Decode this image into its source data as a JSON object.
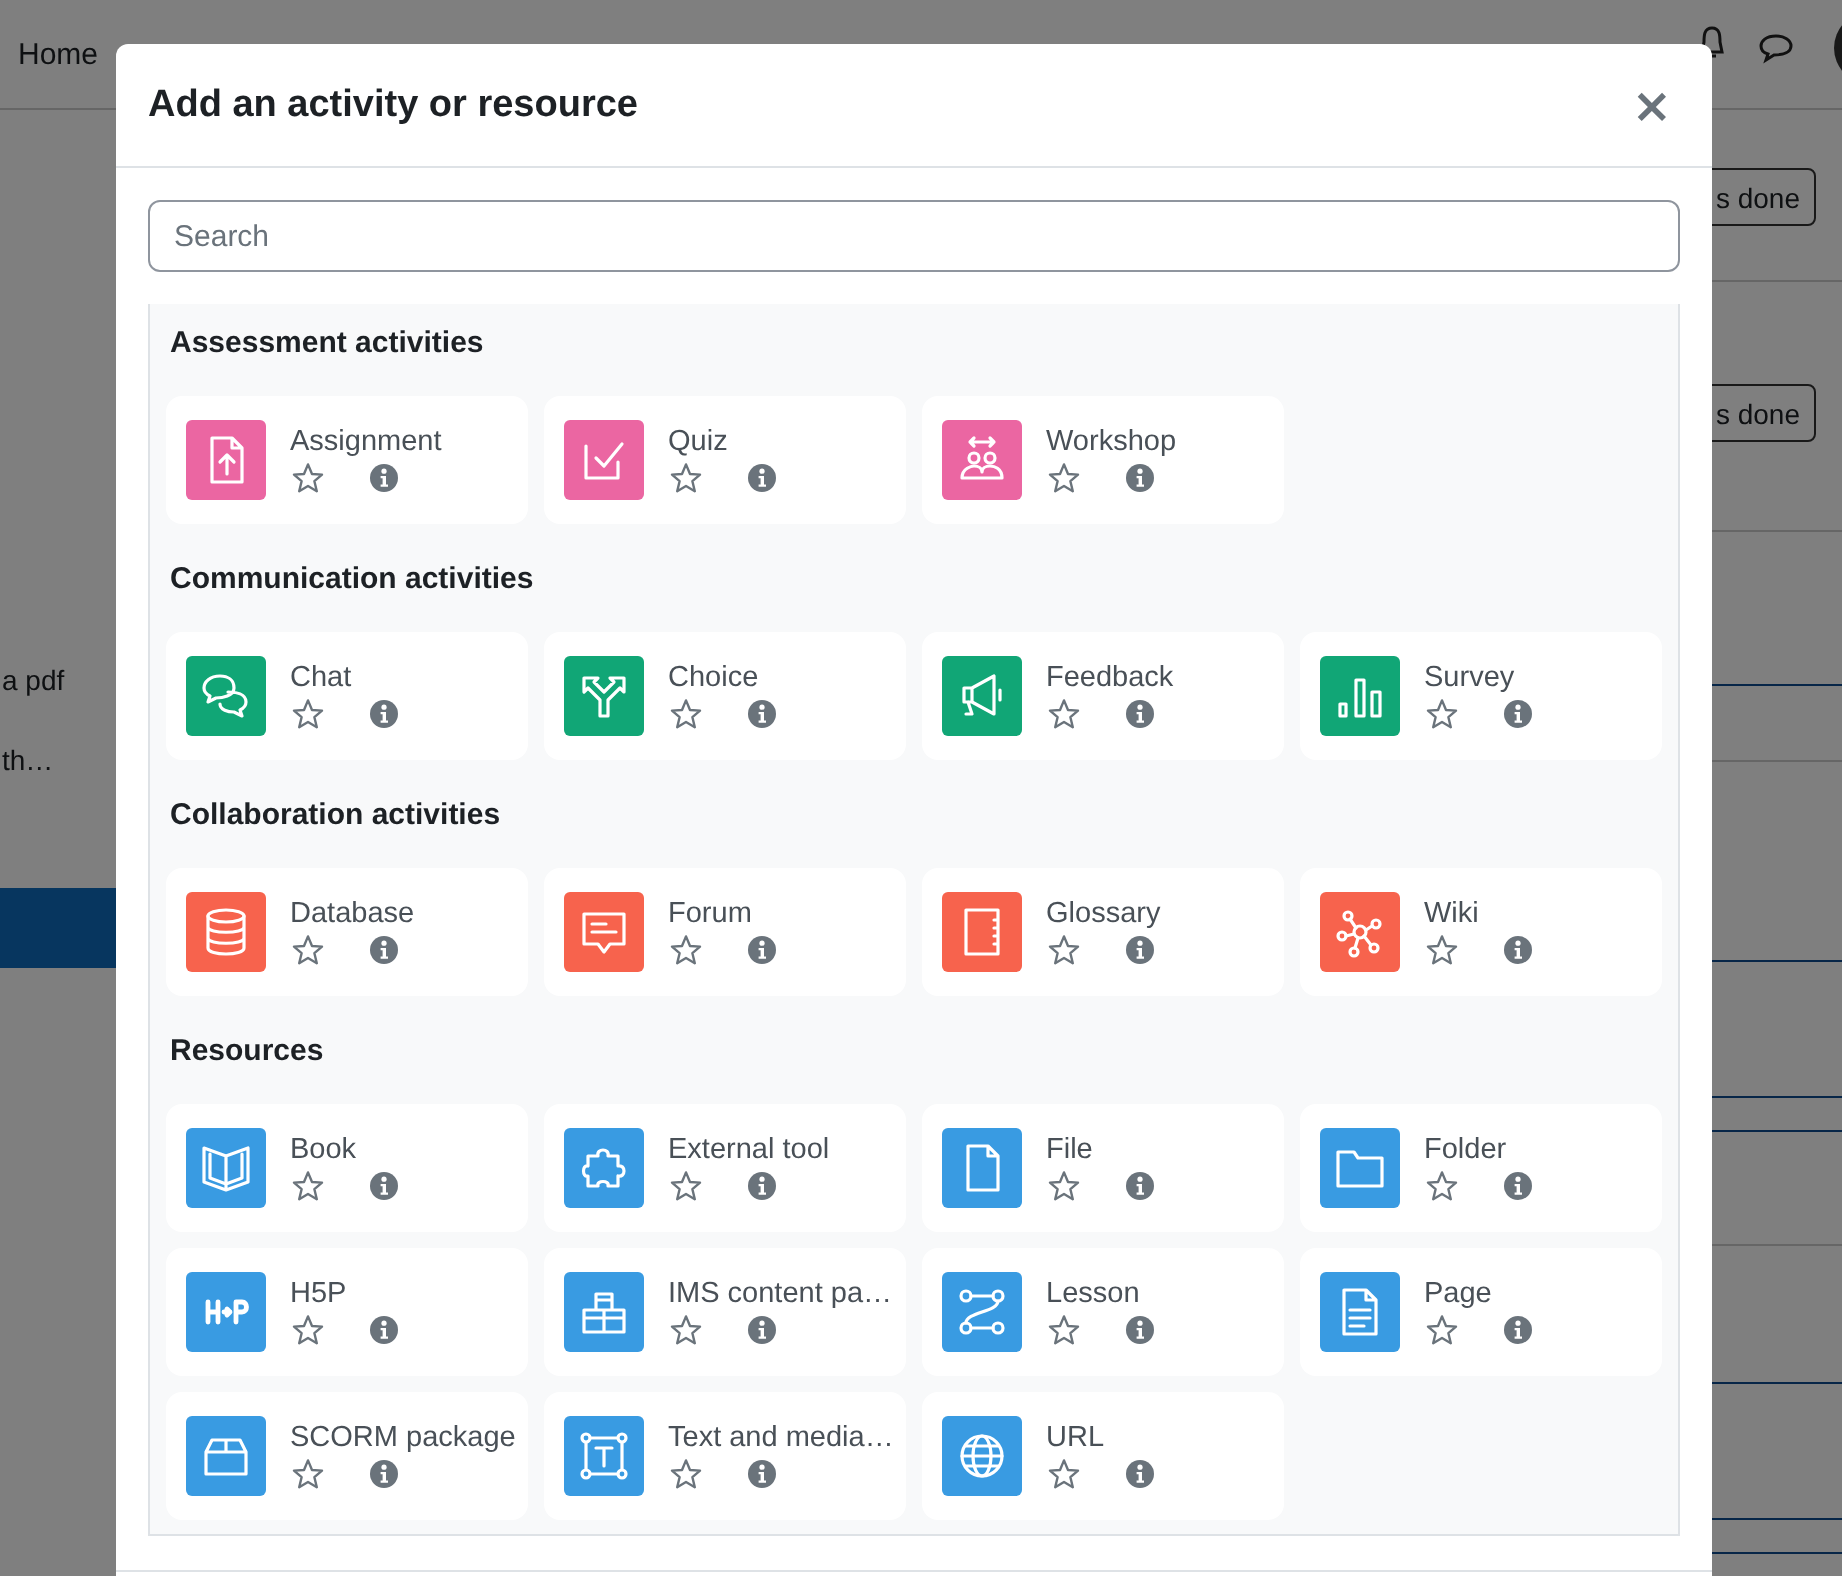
{
  "page": {
    "nav": [
      "Home"
    ],
    "side_texts": [
      "a pdf",
      "th…"
    ],
    "buttons": [
      "s done",
      "s done"
    ]
  },
  "dialog": {
    "title": "Add an activity or resource",
    "close": "×",
    "search": {
      "placeholder": "Search"
    },
    "sections": [
      {
        "title": "Assessment activities",
        "color": "#eb66a2",
        "items": [
          {
            "name": "Assignment",
            "kind": "assignment",
            "starred": false
          },
          {
            "name": "Quiz",
            "kind": "quiz",
            "starred": false
          },
          {
            "name": "Workshop",
            "kind": "workshop",
            "starred": false
          }
        ]
      },
      {
        "title": "Communication activities",
        "color": "#11a676",
        "items": [
          {
            "name": "Chat",
            "kind": "chat",
            "starred": false
          },
          {
            "name": "Choice",
            "kind": "choice",
            "starred": false
          },
          {
            "name": "Feedback",
            "kind": "feedback",
            "starred": false
          },
          {
            "name": "Survey",
            "kind": "survey",
            "starred": false
          }
        ]
      },
      {
        "title": "Collaboration activities",
        "color": "#f7634d",
        "items": [
          {
            "name": "Database",
            "kind": "database",
            "starred": false
          },
          {
            "name": "Forum",
            "kind": "forum",
            "starred": false
          },
          {
            "name": "Glossary",
            "kind": "glossary",
            "starred": false
          },
          {
            "name": "Wiki",
            "kind": "wiki",
            "starred": false
          }
        ]
      },
      {
        "title": "Resources",
        "color": "#399be2",
        "items": [
          {
            "name": "Book",
            "kind": "book",
            "starred": false
          },
          {
            "name": "External tool",
            "kind": "puzzle",
            "starred": false
          },
          {
            "name": "File",
            "kind": "file",
            "starred": false
          },
          {
            "name": "Folder",
            "kind": "folder",
            "starred": false
          },
          {
            "name": "H5P",
            "kind": "h5p",
            "starred": false
          },
          {
            "name": "IMS content pa…",
            "kind": "boxes",
            "starred": false
          },
          {
            "name": "Lesson",
            "kind": "lesson",
            "starred": false
          },
          {
            "name": "Page",
            "kind": "page",
            "starred": false
          },
          {
            "name": "SCORM package",
            "kind": "package",
            "starred": false
          },
          {
            "name": "Text and media…",
            "kind": "textmedia",
            "starred": false
          },
          {
            "name": "URL",
            "kind": "globe",
            "starred": false
          }
        ]
      }
    ]
  }
}
